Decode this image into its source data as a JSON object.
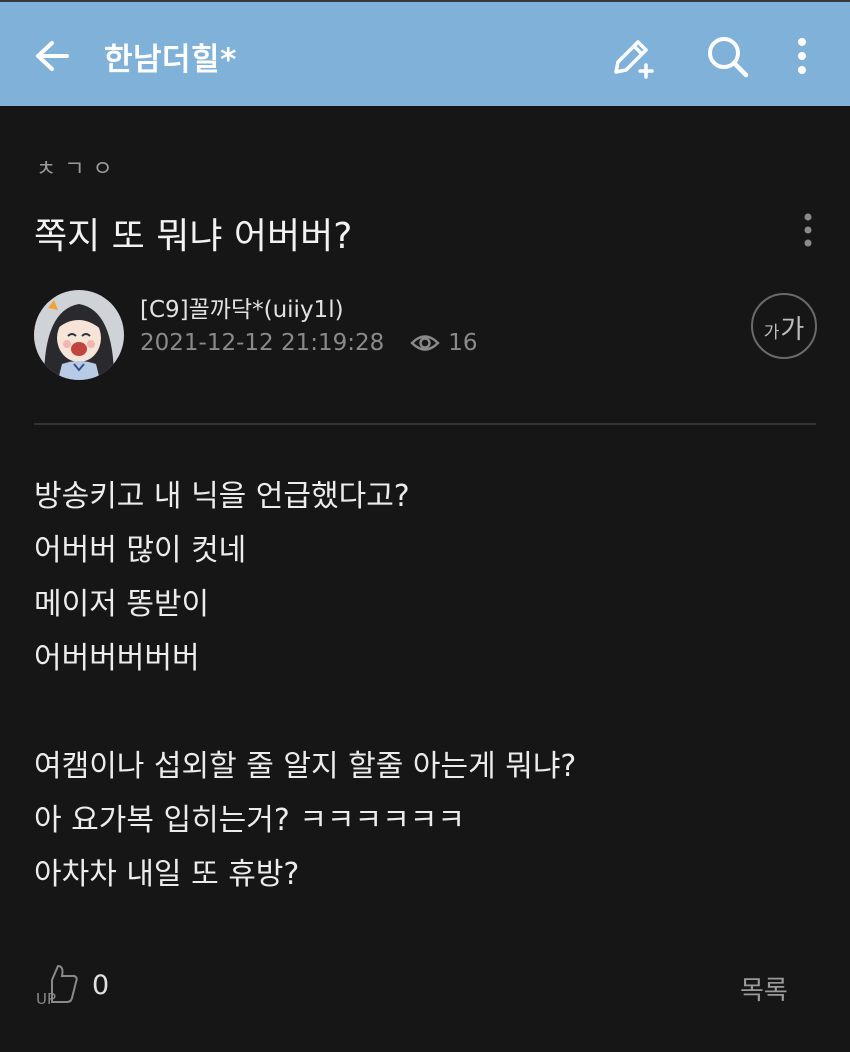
{
  "topbar": {
    "title": "한남더힐*",
    "back_icon": "arrow-left-icon",
    "write_icon": "pencil-plus-icon",
    "search_icon": "search-icon",
    "more_icon": "more-vertical-icon",
    "background": "#80b1d8"
  },
  "post": {
    "category": "ㅊㄱㅇ",
    "title": "쪽지 또 뭐냐 어버버?",
    "author": "[C9]꼴까닥*(uiiy1l)",
    "datetime": "2021-12-12 21:19:28",
    "views": "16",
    "font_toggle": {
      "small": "가",
      "large": "가"
    },
    "body_lines": [
      "방송키고 내 닉을 언급했다고?",
      "어버버 많이 컷네",
      "메이저 똥받이",
      "어버버버버버",
      "",
      "여캠이나 섭외할 줄 알지 할줄 아는게 뭐냐?",
      "아 요가복 입히는거? ㅋㅋㅋㅋㅋㅋ",
      "아차차 내일 또 휴방?"
    ]
  },
  "footer": {
    "like_label": "UP",
    "like_count": "0",
    "list_button": "목록"
  }
}
